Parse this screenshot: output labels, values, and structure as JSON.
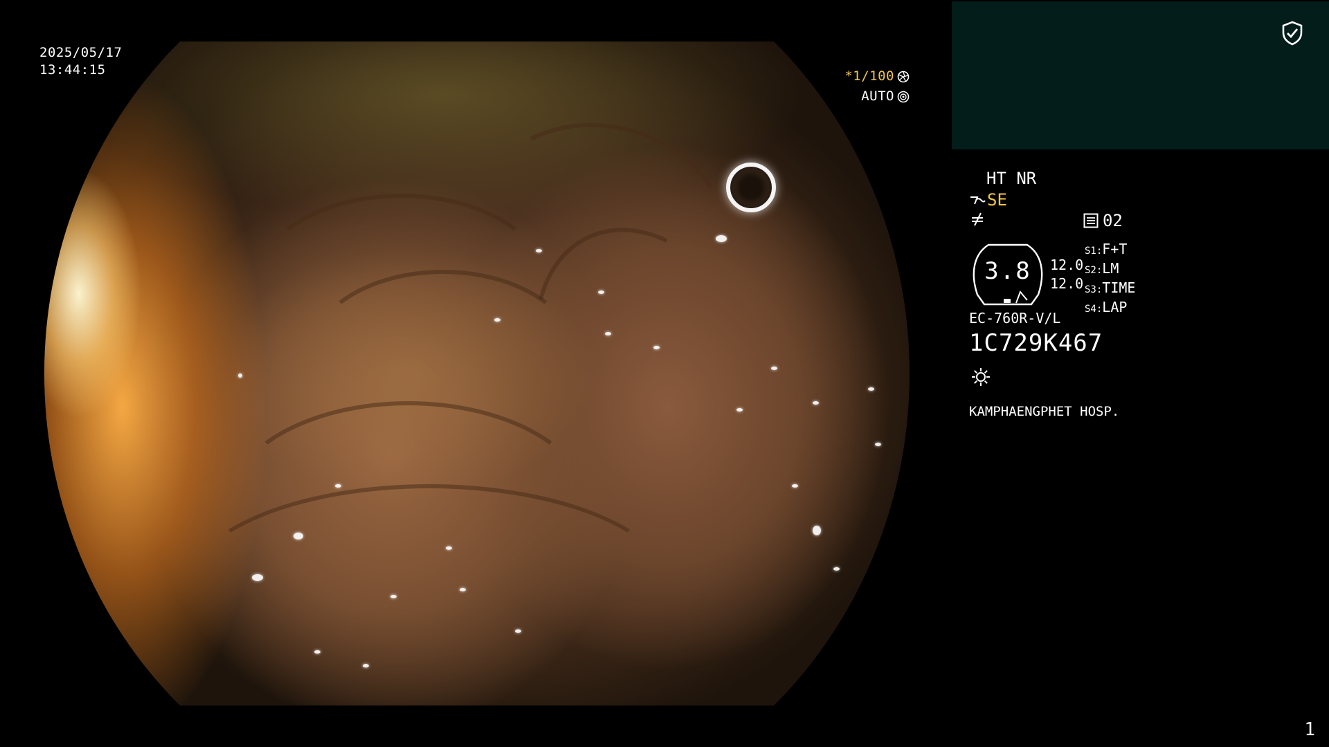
{
  "viewer": {
    "date": "2025/05/17",
    "time": "13:44:15",
    "shutter": "*1/100",
    "iris_mode": "AUTO",
    "frame_number": "1"
  },
  "panel": {
    "enhance": "HT NR",
    "structure_mode": "SE",
    "color_preset": "02",
    "zoom_value": "3.8",
    "value_upper": "12.0",
    "value_lower": "12.0",
    "switch_labels": [
      {
        "key": "S1:",
        "value": "F+T"
      },
      {
        "key": "S2:",
        "value": "LM"
      },
      {
        "key": "S3:",
        "value": "TIME"
      },
      {
        "key": "S4:",
        "value": "LAP"
      }
    ],
    "scope_model": "EC-760R-V/L",
    "scope_serial": "1C729K467",
    "hospital": "KAMPHAENGPHET HOSP."
  },
  "colors": {
    "accent_yellow": "#f2c744",
    "panel_bg": "#021d1a",
    "text": "#ffffff"
  },
  "icons": {
    "shutter": "aperture-icon",
    "iris": "iris-icon",
    "secure": "shield-check-icon",
    "structure": "signal-wave-icon",
    "contrast": "slash-wave-icon",
    "preset": "list-box-icon",
    "light": "sun-icon"
  }
}
